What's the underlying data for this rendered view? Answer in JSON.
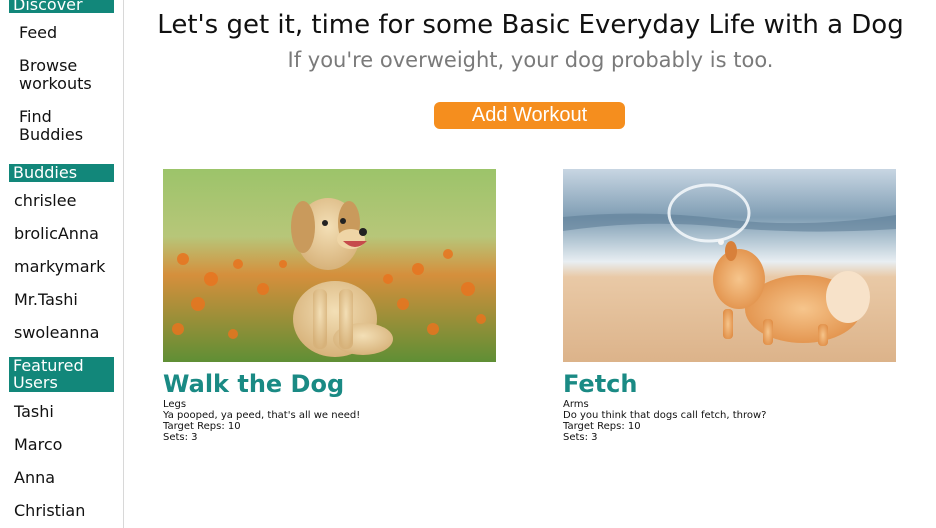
{
  "sidebar": {
    "discover_heading": "Discover",
    "discover_links": [
      "Feed",
      "Browse\nworkouts",
      "Find\nBuddies"
    ],
    "buddies_heading": "Buddies",
    "buddies": [
      "chrislee",
      "brolicAnna",
      "markymark",
      "Mr.Tashi",
      "swoleanna"
    ],
    "featured_heading": "Featured\nUsers",
    "featured": [
      "Tashi",
      "Marco",
      "Anna",
      "Christian"
    ]
  },
  "main": {
    "title": "Let's get it, time for some Basic Everyday Life with a Dog",
    "subtitle": "If you're overweight, your dog probably is too.",
    "add_button": "Add Workout"
  },
  "workouts": [
    {
      "title": "Walk the Dog",
      "muscle": "Legs",
      "description": "Ya pooped, ya peed, that's all we need!",
      "reps": "Target Reps: 10",
      "sets": "Sets: 3",
      "image": "puppy-in-flower-field-photo"
    },
    {
      "title": "Fetch",
      "muscle": "Arms",
      "description": "Do you think that dogs call fetch, throw?",
      "reps": "Target Reps: 10",
      "sets": "Sets: 3",
      "image": "pomeranian-on-beach-photo"
    }
  ],
  "colors": {
    "accent": "#12877a",
    "card_title": "#1a8a84",
    "button": "#f58e1e",
    "subtitle": "#7a7a7a"
  }
}
